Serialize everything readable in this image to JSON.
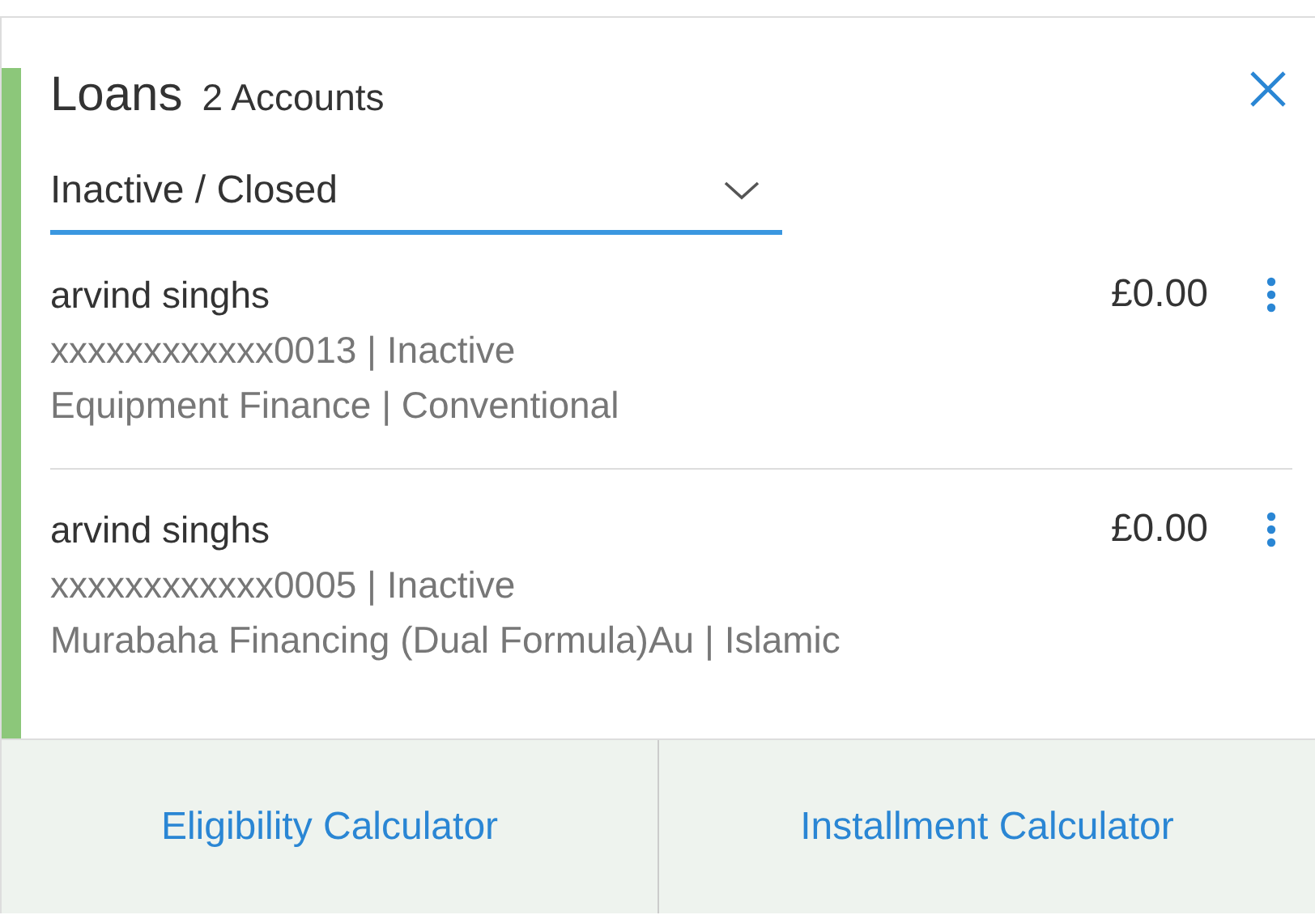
{
  "title": "Loans",
  "count": "2 Accounts",
  "filter": {
    "value": "Inactive / Closed"
  },
  "accounts": [
    {
      "name": "arvind singhs",
      "number": "xxxxxxxxxxxx0013 | Inactive",
      "product": "Equipment Finance | Conventional",
      "amount": "£0.00"
    },
    {
      "name": "arvind singhs",
      "number": "xxxxxxxxxxxx0005 | Inactive",
      "product": "Murabaha Financing (Dual Formula)Au | Islamic",
      "amount": "£0.00"
    }
  ],
  "footer": [
    "Eligibility Calculator",
    "Installment Calculator"
  ]
}
